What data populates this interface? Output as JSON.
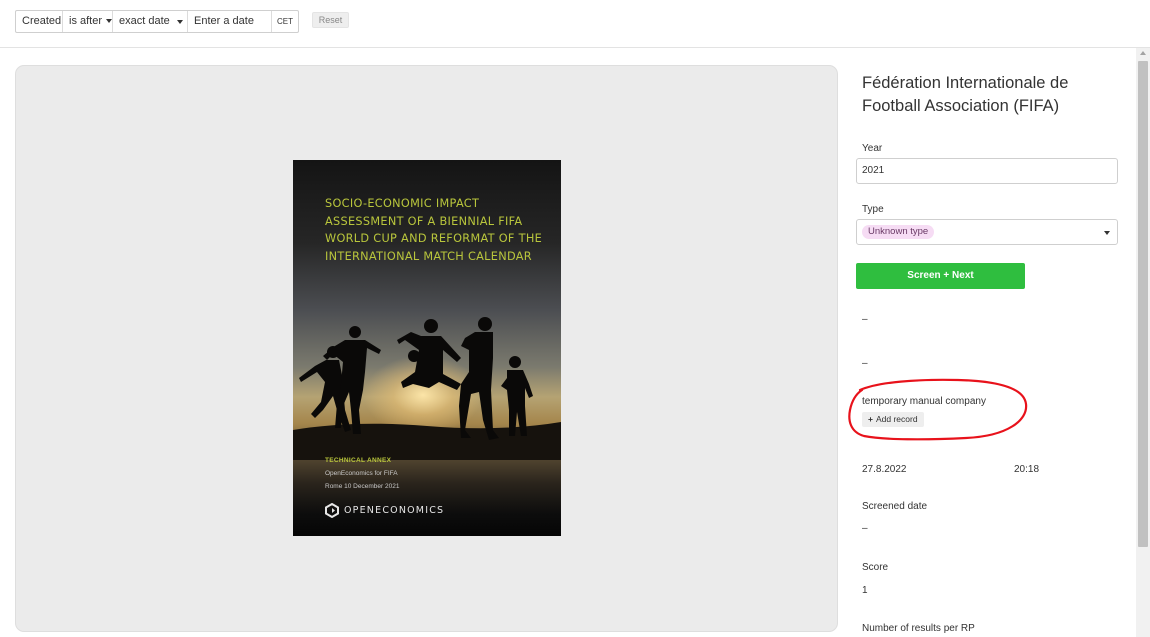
{
  "filter": {
    "field": "Created",
    "operator": "is after",
    "mode": "exact date",
    "date_placeholder": "Enter a date",
    "timezone": "CET",
    "reset_label": "Reset"
  },
  "document": {
    "cover_title": "SOCIO-ECONOMIC IMPACT ASSESSMENT OF A BIENNIAL FIFA WORLD CUP AND REFORMAT OF THE INTERNATIONAL MATCH CALENDAR",
    "cover_annex": "TECHNICAL ANNEX",
    "cover_line1": "OpenEconomics for FIFA",
    "cover_line2": "Rome 10 December 2021",
    "cover_logo_text": "OPENECONOMICS"
  },
  "record": {
    "organization": "Fédération Internationale de Football Association (FIFA)",
    "year_label": "Year",
    "year_value": "2021",
    "type_label": "Type",
    "type_value": "Unknown type",
    "screen_button": "Screen + Next",
    "dash_1": "–",
    "dash_2": "–",
    "company_name": "temporary manual company",
    "add_record_label": "Add record",
    "created_date": "27.8.2022",
    "created_time": "20:18",
    "screened_date_label": "Screened date",
    "screened_date_value": "–",
    "score_label": "Score",
    "score_value": "1",
    "results_label": "Number of results per RP"
  },
  "colors": {
    "primary_button": "#2fbe3f",
    "tag_background": "#f6dcf4",
    "annotation_red": "#e8121b",
    "cover_title": "#b9c63c"
  },
  "icons": {
    "dropdown": "chevron-down-icon",
    "add": "plus-icon",
    "logo": "openeconomics-logo-icon"
  }
}
